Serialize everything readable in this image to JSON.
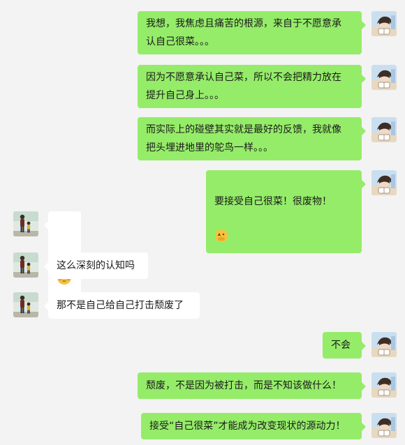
{
  "conversation": {
    "messages": [
      {
        "id": "m1",
        "sender": "me",
        "text": "我想，我焦虑且痛苦的根源，来自于不愿意承\n认自己很菜。。。"
      },
      {
        "id": "m2",
        "sender": "me",
        "text": "因为不愿意承认自己菜，所以不会把精力放在\n提升自己身上。。。"
      },
      {
        "id": "m3",
        "sender": "me",
        "text": "而实际上的碰壁其实就是最好的反馈，我就像\n把头埋进地里的鸵鸟一样。。。"
      },
      {
        "id": "m4",
        "sender": "me",
        "text": "要接受自己很菜！很废物！",
        "emoji": "face-hand-over-mouth-icon"
      },
      {
        "id": "m5",
        "sender": "other",
        "text": "",
        "emoji": "flushed-face-icon"
      },
      {
        "id": "m6",
        "sender": "other",
        "text": "这么深刻的认知吗"
      },
      {
        "id": "m7",
        "sender": "other",
        "text": "那不是自己给自己打击颓废了"
      },
      {
        "id": "m8",
        "sender": "me",
        "text": "不会"
      },
      {
        "id": "m9",
        "sender": "me",
        "text": "颓废，不是因为被打击，而是不知该做什么！"
      },
      {
        "id": "m10",
        "sender": "me",
        "text": "接受“自己很菜”才能成为改变现状的源动力！"
      }
    ]
  },
  "colors": {
    "background": "#f3f3f3",
    "outgoing_bubble": "#95ec69",
    "incoming_bubble": "#ffffff"
  },
  "avatars": {
    "me": "anime-person-reading-avatar-icon",
    "other": "parent-and-child-standing-avatar-icon"
  }
}
